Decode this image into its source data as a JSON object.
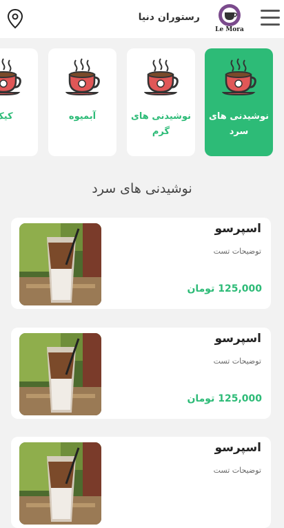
{
  "header": {
    "restaurant_name": "رستوران دنیا",
    "logo_text": "Le Mora",
    "icons": [
      "menu-icon",
      "location-icon"
    ]
  },
  "categories": [
    {
      "label": "نوشیدنی های سرد",
      "active": true
    },
    {
      "label": "نوشیدنی های گرم",
      "active": false
    },
    {
      "label": "آبمیوه",
      "active": false
    },
    {
      "label": "کیک",
      "active": false
    }
  ],
  "section_title": "نوشیدنی های سرد",
  "products": [
    {
      "name": "اسپرسو",
      "description": "توضیحات تست",
      "price": "125,000 تومان"
    },
    {
      "name": "اسپرسو",
      "description": "توضیحات تست",
      "price": "125,000 تومان"
    },
    {
      "name": "اسپرسو",
      "description": "توضیحات تست",
      "price": ""
    }
  ],
  "colors": {
    "accent": "#2dbb77",
    "background": "#f2f2f2",
    "cup": "#e05757"
  }
}
